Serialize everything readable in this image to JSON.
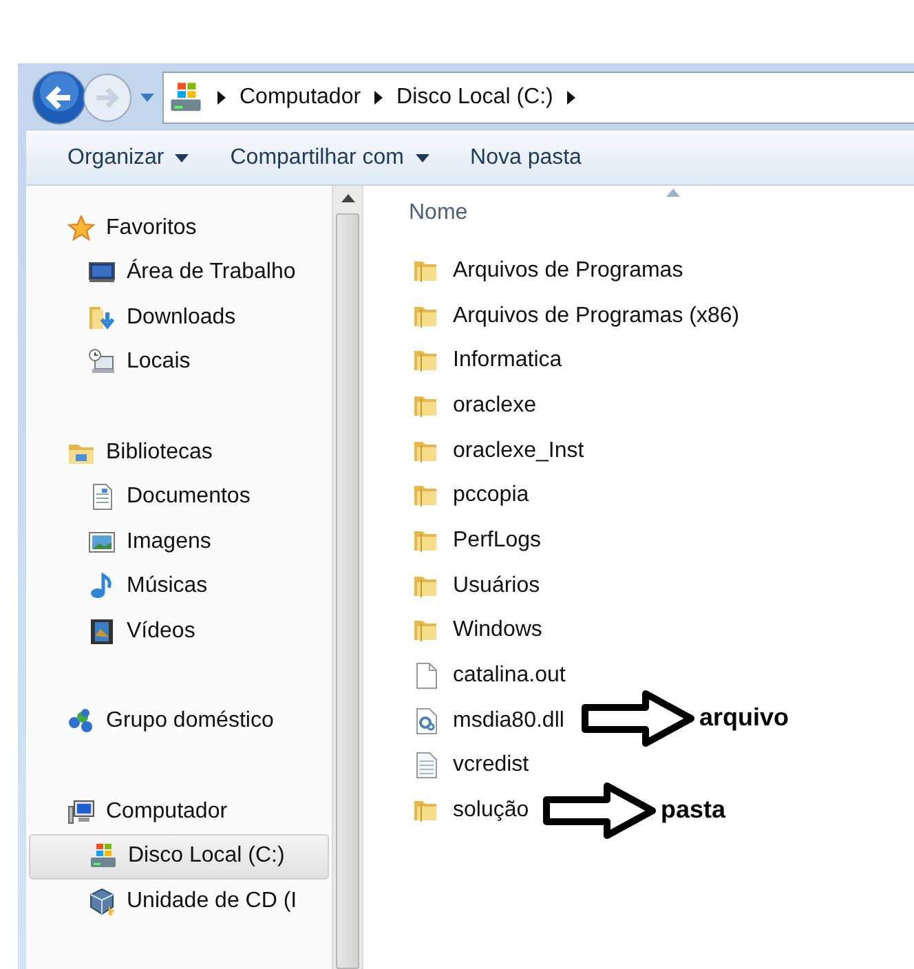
{
  "address_bar": {
    "crumbs": [
      "Computador",
      "Disco Local (C:)"
    ]
  },
  "toolbar": [
    {
      "label": "Organizar",
      "dropdown": true
    },
    {
      "label": "Compartilhar com",
      "dropdown": true
    },
    {
      "label": "Nova pasta",
      "dropdown": false
    }
  ],
  "sidebar": {
    "groups": [
      {
        "label": "Favoritos",
        "kind": "star",
        "children": [
          {
            "label": "Área de Trabalho",
            "kind": "desktop",
            "selected": false
          },
          {
            "label": "Downloads",
            "kind": "downloads",
            "selected": false
          },
          {
            "label": "Locais",
            "kind": "places",
            "selected": false
          }
        ]
      },
      {
        "label": "Bibliotecas",
        "kind": "library",
        "children": [
          {
            "label": "Documentos",
            "kind": "document",
            "selected": false
          },
          {
            "label": "Imagens",
            "kind": "pictures",
            "selected": false
          },
          {
            "label": "Músicas",
            "kind": "music",
            "selected": false
          },
          {
            "label": "Vídeos",
            "kind": "video",
            "selected": false
          }
        ]
      },
      {
        "label": "Grupo doméstico",
        "kind": "homegroup"
      },
      {
        "label": "Computador",
        "kind": "computer",
        "children": [
          {
            "label": "Disco Local (C:)",
            "kind": "drive",
            "selected": true
          },
          {
            "label": "Unidade de CD (I",
            "kind": "cd",
            "selected": false
          }
        ]
      }
    ]
  },
  "file_list": {
    "column": "Nome",
    "items": [
      {
        "name": "Arquivos de Programas",
        "kind": "folder"
      },
      {
        "name": "Arquivos de Programas (x86)",
        "kind": "folder"
      },
      {
        "name": "Informatica",
        "kind": "folder"
      },
      {
        "name": "oraclexe",
        "kind": "folder"
      },
      {
        "name": "oraclexe_Inst",
        "kind": "folder"
      },
      {
        "name": "pccopia",
        "kind": "folder"
      },
      {
        "name": "PerfLogs",
        "kind": "folder"
      },
      {
        "name": "Usuários",
        "kind": "folder"
      },
      {
        "name": "Windows",
        "kind": "folder"
      },
      {
        "name": "catalina.out",
        "kind": "file"
      },
      {
        "name": "msdia80.dll",
        "kind": "dll"
      },
      {
        "name": "vcredist",
        "kind": "text"
      },
      {
        "name": "solução",
        "kind": "folder"
      }
    ]
  },
  "annotations": [
    {
      "label": "arquivo"
    },
    {
      "label": "pasta"
    }
  ]
}
